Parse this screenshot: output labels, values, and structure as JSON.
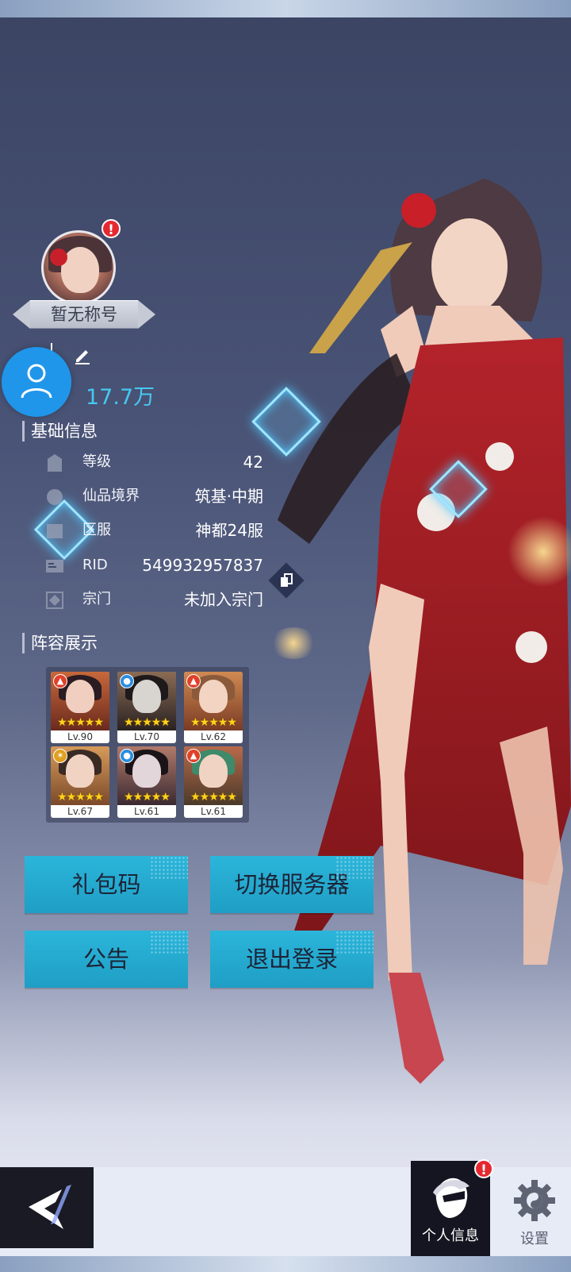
{
  "profile": {
    "title_plate": "暂无称号",
    "power": "17.7万",
    "alert_mark": "!"
  },
  "basic_info": {
    "heading": "基础信息",
    "rows": [
      {
        "label": "等级",
        "value": "42",
        "icon": "rank-icon"
      },
      {
        "label": "仙品境界",
        "value": "筑基·中期",
        "icon": "realm-icon"
      },
      {
        "label": "区服",
        "value": "神都24服",
        "icon": "server-icon"
      },
      {
        "label": "RID",
        "value": "549932957837",
        "icon": "id-card-icon"
      },
      {
        "label": "宗门",
        "value": "未加入宗门",
        "icon": "sect-icon"
      }
    ]
  },
  "lineup": {
    "heading": "阵容展示",
    "heroes": [
      {
        "level": "Lv.90",
        "element": "fire",
        "stars": "★★★★★"
      },
      {
        "level": "Lv.70",
        "element": "water",
        "stars": "★★★★★"
      },
      {
        "level": "Lv.62",
        "element": "fire",
        "stars": "★★★★★"
      },
      {
        "level": "Lv.67",
        "element": "light",
        "stars": "★★★★★"
      },
      {
        "level": "Lv.61",
        "element": "water",
        "stars": "★★★★★"
      },
      {
        "level": "Lv.61",
        "element": "fire",
        "stars": "★★★★★"
      }
    ]
  },
  "actions": {
    "gift_code": "礼包码",
    "switch_server": "切换服务器",
    "notice": "公告",
    "logout": "退出登录"
  },
  "nav": {
    "profile_label": "个人信息",
    "settings_label": "设置"
  },
  "colors": {
    "accent": "#2bb5da",
    "power": "#46c8f0",
    "alert": "#e5282f",
    "float_button": "#1f96ea"
  }
}
